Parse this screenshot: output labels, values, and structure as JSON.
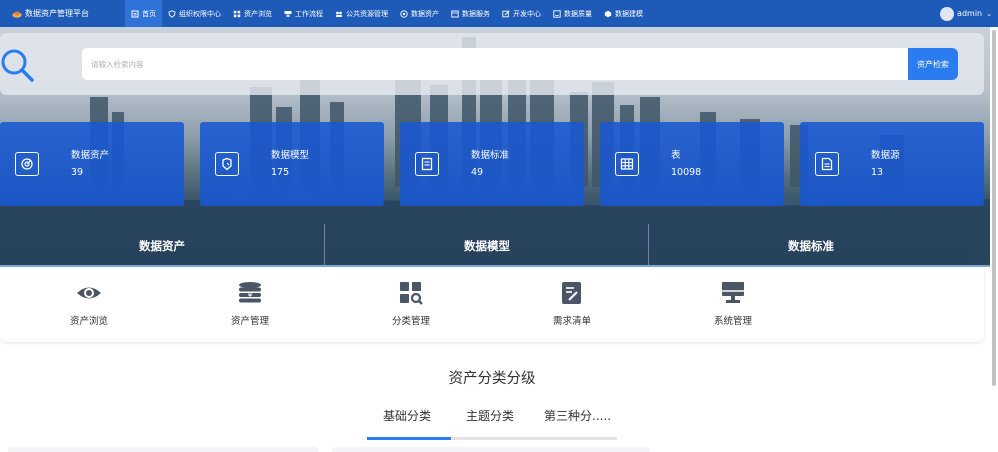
{
  "app": {
    "title": "数据资产管理平台"
  },
  "nav": {
    "items": [
      {
        "label": "首页",
        "icon": "home-icon",
        "active": true
      },
      {
        "label": "组织权限中心",
        "icon": "shield-icon"
      },
      {
        "label": "资产浏览",
        "icon": "grid-icon"
      },
      {
        "label": "工作流程",
        "icon": "workflow-icon"
      },
      {
        "label": "公共资源管理",
        "icon": "users-icon"
      },
      {
        "label": "数据资产",
        "icon": "database-icon"
      },
      {
        "label": "数据服务",
        "icon": "service-icon"
      },
      {
        "label": "开发中心",
        "icon": "edit-icon"
      },
      {
        "label": "数据质量",
        "icon": "quality-icon"
      },
      {
        "label": "数据建模",
        "icon": "cube-icon"
      }
    ]
  },
  "user": {
    "name": "admin"
  },
  "search": {
    "placeholder": "请输入检索内容",
    "button_label": "资产检索"
  },
  "stats": [
    {
      "label": "数据资产",
      "value": "39",
      "icon": "asset-icon"
    },
    {
      "label": "数据模型",
      "value": "175",
      "icon": "model-icon"
    },
    {
      "label": "数据标准",
      "value": "49",
      "icon": "standard-icon"
    },
    {
      "label": "表",
      "value": "10098",
      "icon": "table-icon"
    },
    {
      "label": "数据源",
      "value": "13",
      "icon": "datasource-icon"
    }
  ],
  "hero_tabs": [
    "数据资产",
    "数据模型",
    "数据标准"
  ],
  "quick_links": [
    {
      "label": "资产浏览",
      "icon": "eye-icon"
    },
    {
      "label": "资产管理",
      "icon": "coins-icon"
    },
    {
      "label": "分类管理",
      "icon": "category-search-icon"
    },
    {
      "label": "需求清单",
      "icon": "requirement-list-icon"
    },
    {
      "label": "系统管理",
      "icon": "monitor-icon"
    }
  ],
  "classification": {
    "title": "资产分类分级",
    "tabs": [
      "基础分类",
      "主题分类",
      "第三种分....."
    ],
    "active_tab": 0
  },
  "colors": {
    "nav": "#1e5bb8",
    "accent": "#2a7cf0",
    "stat_card": "#1858d2"
  }
}
